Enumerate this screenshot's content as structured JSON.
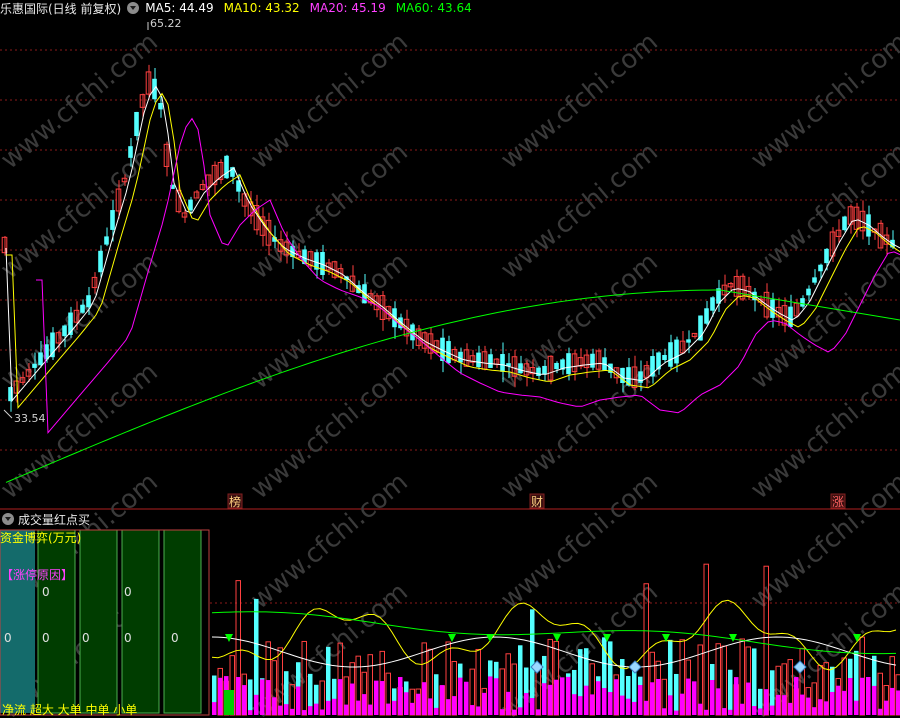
{
  "header": {
    "stock_label": "乐惠国际(日线 前复权)",
    "ma5": "MA5: 44.49",
    "ma10": "MA10: 43.32",
    "ma20": "MA20: 45.19",
    "ma60": "MA60: 43.64"
  },
  "colors": {
    "ma5": "#ffffff",
    "ma10": "#ffff00",
    "ma20": "#ff00ff",
    "ma60": "#00ff00",
    "up": "#ff4040",
    "down": "#54ffff",
    "grid": "#8b1a1a"
  },
  "price_chart": {
    "high_label": "65.22",
    "low_label": "33.54",
    "markers": [
      "榜",
      "财",
      "涨"
    ]
  },
  "indicator": {
    "title": "成交量红点买",
    "panel_title": "资金博弈(万元)",
    "reason_label": "【涨停原因】",
    "values": [
      "0",
      "0",
      "0",
      "0",
      "0",
      "0",
      "0"
    ],
    "legend": "净流 超大 大单 中单 小单"
  },
  "watermark": "www.cfchi.com"
}
